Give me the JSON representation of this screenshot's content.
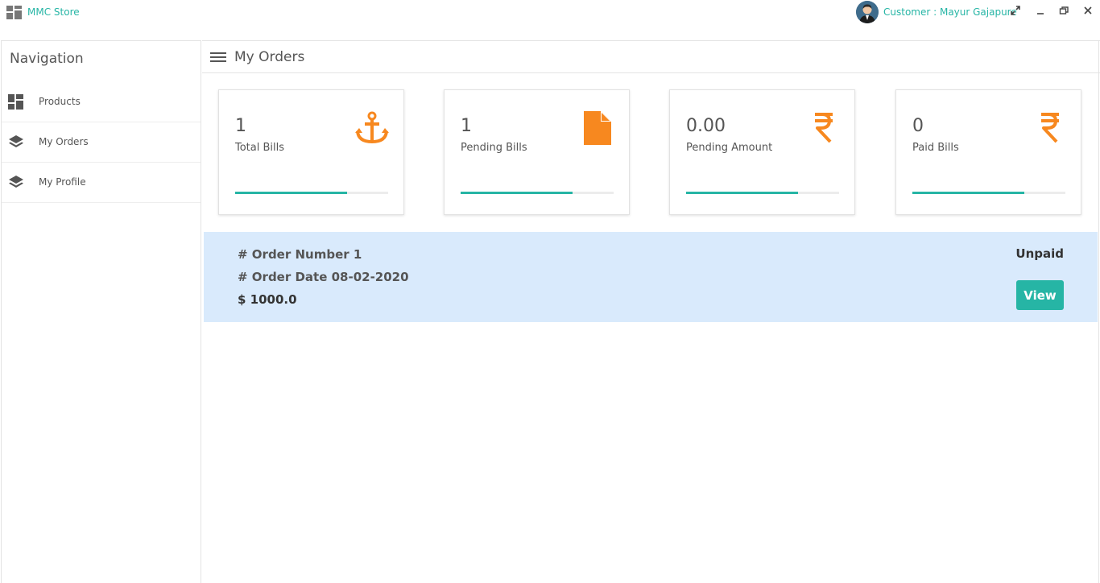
{
  "app": {
    "title": "MMC Store",
    "customer_label": "Customer : Mayur Gajapure"
  },
  "window_controls": {
    "expand_icon": "expand-icon",
    "minimize_icon": "minimize-icon",
    "restore_icon": "restore-icon",
    "close_icon": "close-icon"
  },
  "sidebar": {
    "title": "Navigation",
    "items": [
      {
        "label": "Products",
        "icon": "dashboard-icon"
      },
      {
        "label": "My Orders",
        "icon": "layers-icon"
      },
      {
        "label": "My Profile",
        "icon": "layers-icon"
      }
    ]
  },
  "header": {
    "title": "My Orders"
  },
  "stats": [
    {
      "value": "1",
      "label": "Total Bills",
      "icon": "anchor-icon",
      "progress_percent": 73
    },
    {
      "value": "1",
      "label": "Pending Bills",
      "icon": "file-icon",
      "progress_percent": 73
    },
    {
      "value": "0.00",
      "label": "Pending Amount",
      "icon": "rupee-icon",
      "progress_percent": 73
    },
    {
      "value": "0",
      "label": "Paid Bills",
      "icon": "rupee-icon",
      "progress_percent": 73
    }
  ],
  "order": {
    "number_line": "# Order Number 1",
    "date_line": "# Order Date 08-02-2020",
    "amount_line": "$ 1000.0",
    "status": "Unpaid",
    "view_label": "View"
  },
  "colors": {
    "accent": "#26b5a5",
    "icon_orange": "#f7881f",
    "order_bg": "#d9eafc"
  }
}
